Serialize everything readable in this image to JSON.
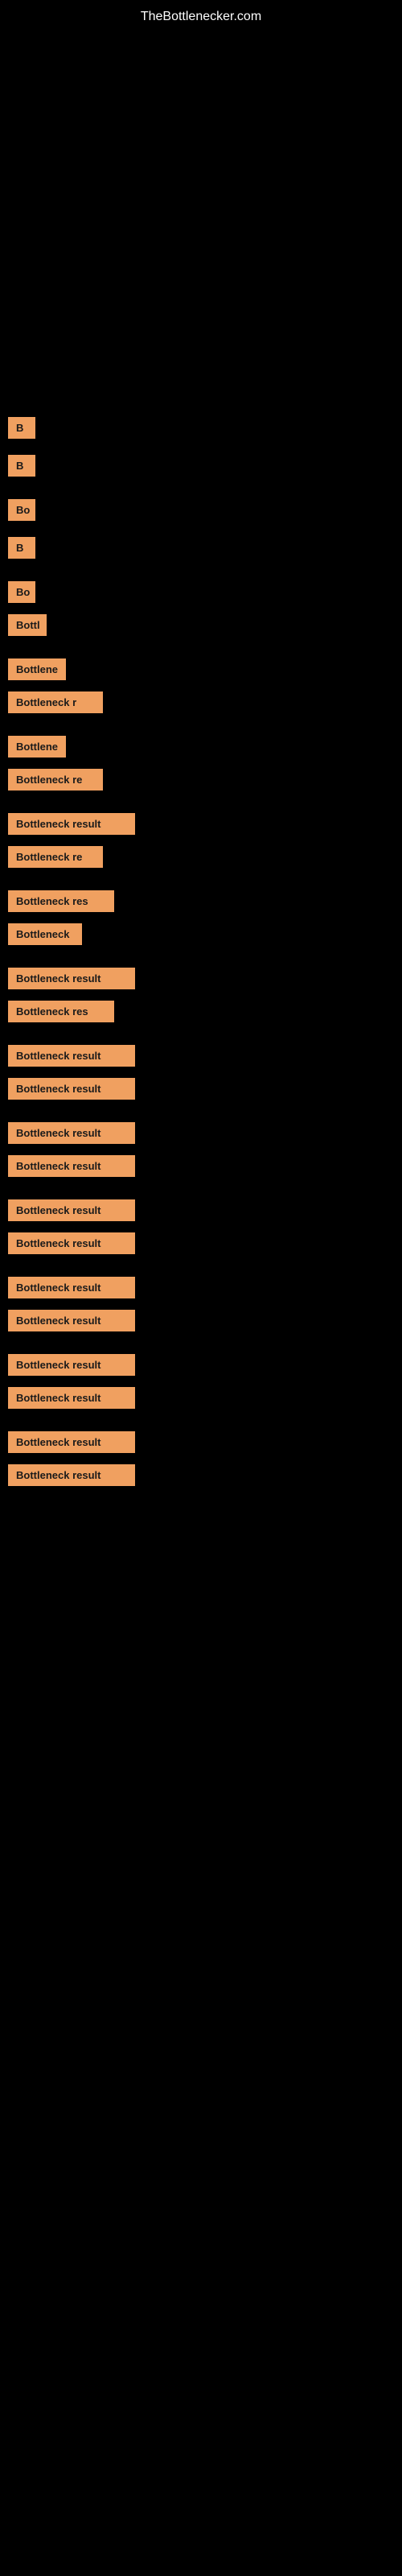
{
  "site": {
    "title": "TheBottlenecker.com"
  },
  "items": [
    {
      "id": 1,
      "label": "B",
      "size": "xs"
    },
    {
      "id": 2,
      "label": "B",
      "size": "xs"
    },
    {
      "id": 3,
      "label": "Bo",
      "size": "xs"
    },
    {
      "id": 4,
      "label": "B",
      "size": "xs"
    },
    {
      "id": 5,
      "label": "Bo",
      "size": "xs"
    },
    {
      "id": 6,
      "label": "Bottl",
      "size": "sm"
    },
    {
      "id": 7,
      "label": "Bottlene",
      "size": "md"
    },
    {
      "id": 8,
      "label": "Bottleneck r",
      "size": "xl"
    },
    {
      "id": 9,
      "label": "Bottlene",
      "size": "md"
    },
    {
      "id": 10,
      "label": "Bottleneck re",
      "size": "xl"
    },
    {
      "id": 11,
      "label": "Bottleneck result",
      "size": "full"
    },
    {
      "id": 12,
      "label": "Bottleneck re",
      "size": "xl"
    },
    {
      "id": 13,
      "label": "Bottleneck res",
      "size": "xxl"
    },
    {
      "id": 14,
      "label": "Bottleneck",
      "size": "lg"
    },
    {
      "id": 15,
      "label": "Bottleneck result",
      "size": "full"
    },
    {
      "id": 16,
      "label": "Bottleneck res",
      "size": "xxl"
    },
    {
      "id": 17,
      "label": "Bottleneck result",
      "size": "full"
    },
    {
      "id": 18,
      "label": "Bottleneck result",
      "size": "full"
    },
    {
      "id": 19,
      "label": "Bottleneck result",
      "size": "full"
    },
    {
      "id": 20,
      "label": "Bottleneck result",
      "size": "full"
    },
    {
      "id": 21,
      "label": "Bottleneck result",
      "size": "full"
    },
    {
      "id": 22,
      "label": "Bottleneck result",
      "size": "full"
    },
    {
      "id": 23,
      "label": "Bottleneck result",
      "size": "full"
    },
    {
      "id": 24,
      "label": "Bottleneck result",
      "size": "full"
    },
    {
      "id": 25,
      "label": "Bottleneck result",
      "size": "full"
    },
    {
      "id": 26,
      "label": "Bottleneck result",
      "size": "full"
    },
    {
      "id": 27,
      "label": "Bottleneck result",
      "size": "full"
    },
    {
      "id": 28,
      "label": "Bottleneck result",
      "size": "full"
    }
  ],
  "colors": {
    "background": "#000000",
    "badge": "#f0a060",
    "text": "#ffffff",
    "badge_text": "#1a1a1a"
  }
}
